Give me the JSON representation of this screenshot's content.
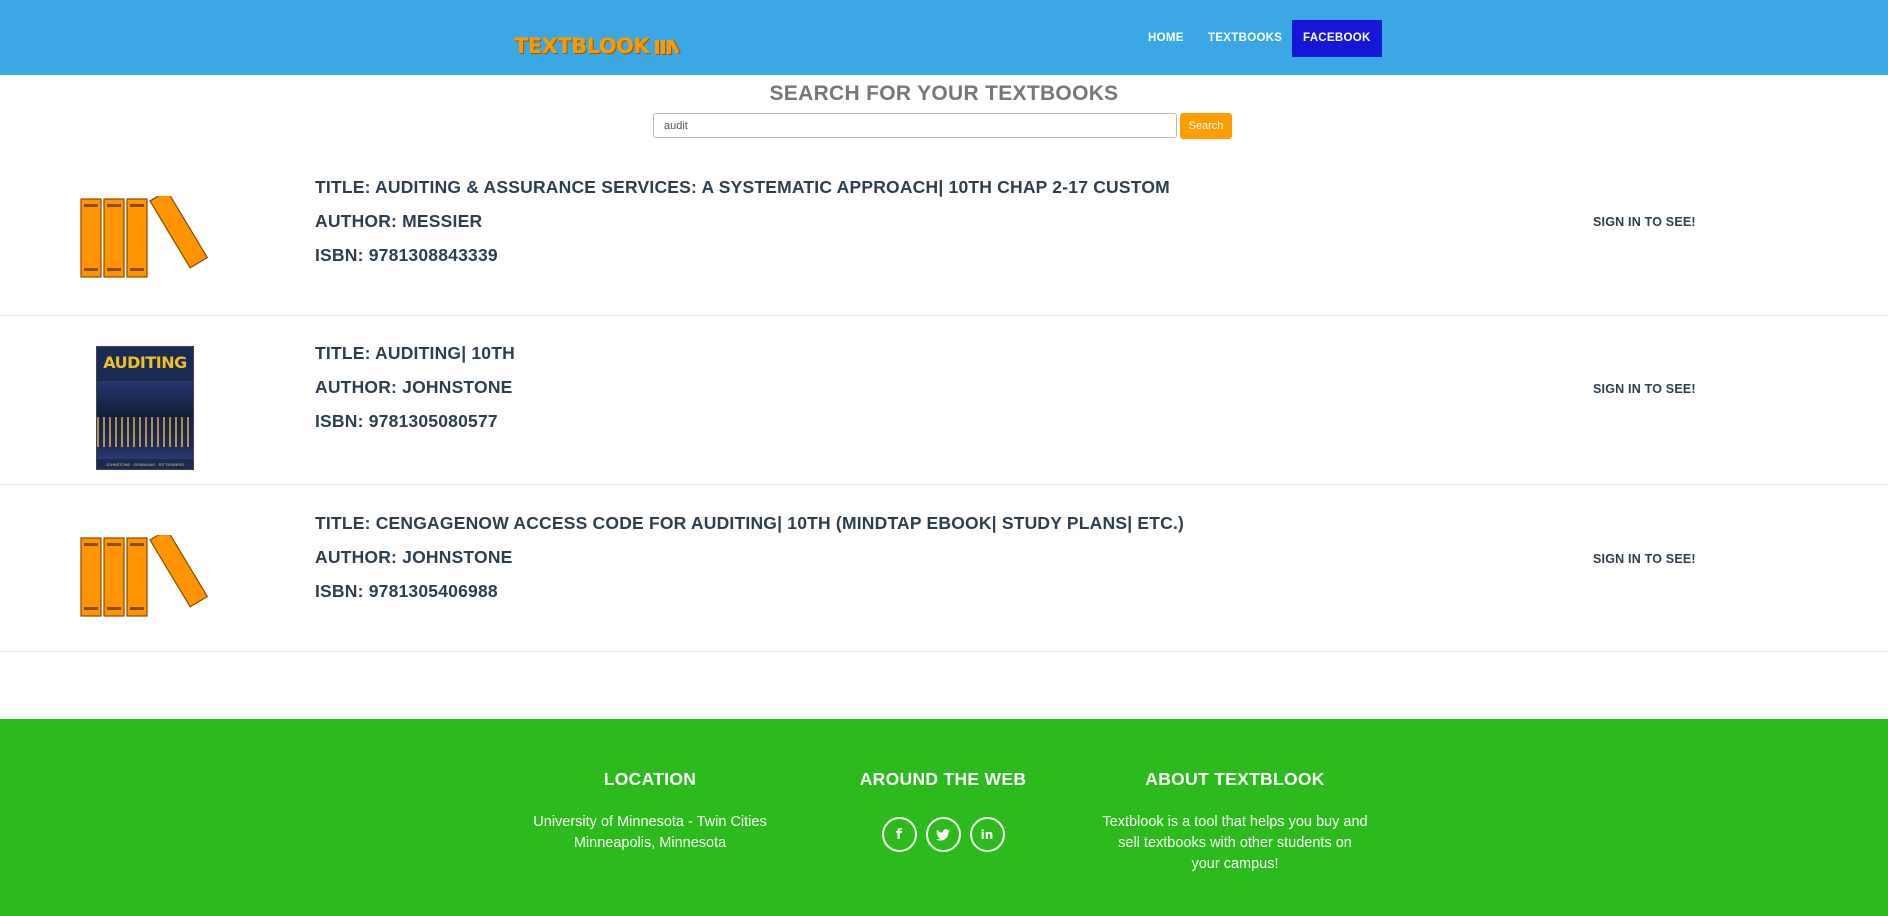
{
  "navbar": {
    "brand": "TEXTBLOOK",
    "items": [
      {
        "label": "HOME",
        "active": false
      },
      {
        "label": "TEXTBOOKS",
        "active": false
      },
      {
        "label": "FACEBOOK",
        "active": true
      }
    ]
  },
  "search": {
    "title": "SEARCH FOR YOUR TEXTBOOKS",
    "value": "audit",
    "button_label": "Search"
  },
  "results": [
    {
      "thumbnail": "books-stack-icon",
      "title": "TITLE: AUDITING & ASSURANCE SERVICES: A SYSTEMATIC APPROACH| 10TH CHAP 2-17 CUSTOM",
      "author": "AUTHOR: MESSIER",
      "isbn": "ISBN: 9781308843339",
      "action": "SIGN IN TO SEE!"
    },
    {
      "thumbnail": "book-cover",
      "cover_title": "AUDITING",
      "cover_authors": "JOHNSTONE · GRAMLING · RITTENBERG",
      "title": "TITLE: AUDITING| 10TH",
      "author": "AUTHOR: JOHNSTONE",
      "isbn": "ISBN: 9781305080577",
      "action": "SIGN IN TO SEE!"
    },
    {
      "thumbnail": "books-stack-icon",
      "title": "TITLE: CENGAGENOW ACCESS CODE FOR AUDITING| 10TH (MINDTAP EBOOK| STUDY PLANS| ETC.)",
      "author": "AUTHOR: JOHNSTONE",
      "isbn": "ISBN: 9781305406988",
      "action": "SIGN IN TO SEE!"
    }
  ],
  "footer": {
    "location": {
      "heading": "LOCATION",
      "line1": "University of Minnesota - Twin Cities",
      "line2": "Minneapolis, Minnesota"
    },
    "web": {
      "heading": "AROUND THE WEB",
      "icons": [
        "facebook-icon",
        "twitter-icon",
        "linkedin-icon"
      ]
    },
    "about": {
      "heading": "ABOUT TEXTBLOOK",
      "line1": "Textblook is a tool that helps you buy and",
      "line2": "sell textbooks with other students on",
      "line3": "your campus!"
    }
  },
  "colors": {
    "navbar": "#3aa8e5",
    "brand": "#ff9900",
    "nav_active": "#1616d8",
    "search_button": "#ff9d00",
    "footer": "#2cbb1d",
    "book_orange": "#ff9400"
  }
}
